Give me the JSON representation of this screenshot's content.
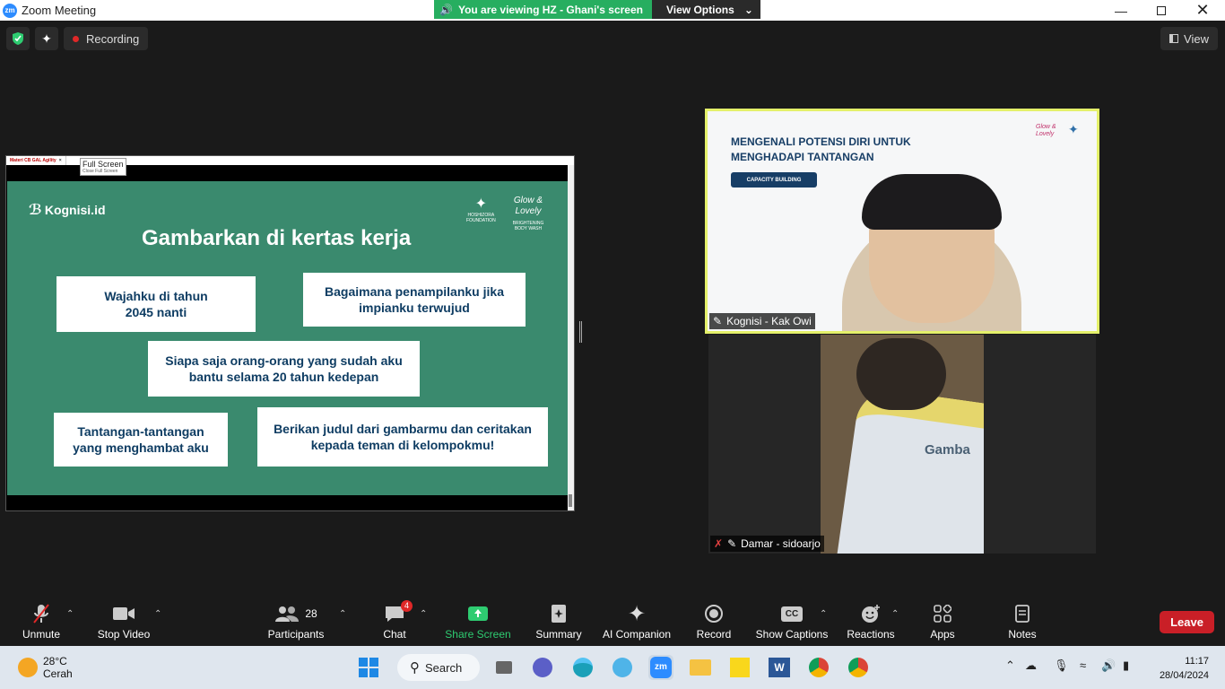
{
  "window": {
    "title": "Zoom Meeting"
  },
  "banner": {
    "viewing": "You are viewing HZ - Ghani's screen",
    "view_options": "View Options"
  },
  "topbar": {
    "recording": "Recording",
    "view": "View"
  },
  "shared_screen": {
    "tab_title": "Materi CB GAL Agility",
    "fullscreen_tip": "Full Screen",
    "fullscreen_sub": "Close Full Screen",
    "slide": {
      "brand": "Kognisi.id",
      "title": "Gambarkan di kertas kerja",
      "partner1_name": "HOSHIZORA",
      "partner1_sub": "FOUNDATION",
      "partner2_name": "Glow & Lovely",
      "partner2_sub": "BRIGHTENING BODY WASH",
      "cards": [
        "Wajahku di tahun 2045 nanti",
        "Bagaimana penampilanku jika impianku terwujud",
        "Siapa saja orang-orang yang sudah aku bantu selama 20 tahun kedepan",
        "Tantangan-tantangan yang menghambat aku",
        "Berikan judul dari gambarmu dan ceritakan kepada teman di kelompokmu!"
      ]
    }
  },
  "videos": [
    {
      "name": "Kognisi - Kak Owi",
      "bg_title": "MENGENALI POTENSI DIRI UNTUK MENGHADAPI TANTANGAN",
      "bg_badge": "CAPACITY BUILDING",
      "bg_logo": "Glow & Lovely"
    },
    {
      "name": "Damar - sidoarjo",
      "paper_text": "Gamba"
    }
  ],
  "toolbar": {
    "unmute": "Unmute",
    "stop_video": "Stop Video",
    "participants": "Participants",
    "participants_count": "28",
    "chat": "Chat",
    "chat_badge": "4",
    "share_screen": "Share Screen",
    "summary": "Summary",
    "ai_companion": "AI Companion",
    "record": "Record",
    "show_captions": "Show Captions",
    "reactions": "Reactions",
    "apps": "Apps",
    "notes": "Notes",
    "leave": "Leave"
  },
  "taskbar": {
    "temp": "28°C",
    "weather": "Cerah",
    "search": "Search",
    "time": "11:17",
    "date": "28/04/2024"
  },
  "colors": {
    "accent": "#2d8cff",
    "leave": "#c91f27",
    "share_green": "#27ae60",
    "speaker_border": "#e4f06a"
  }
}
